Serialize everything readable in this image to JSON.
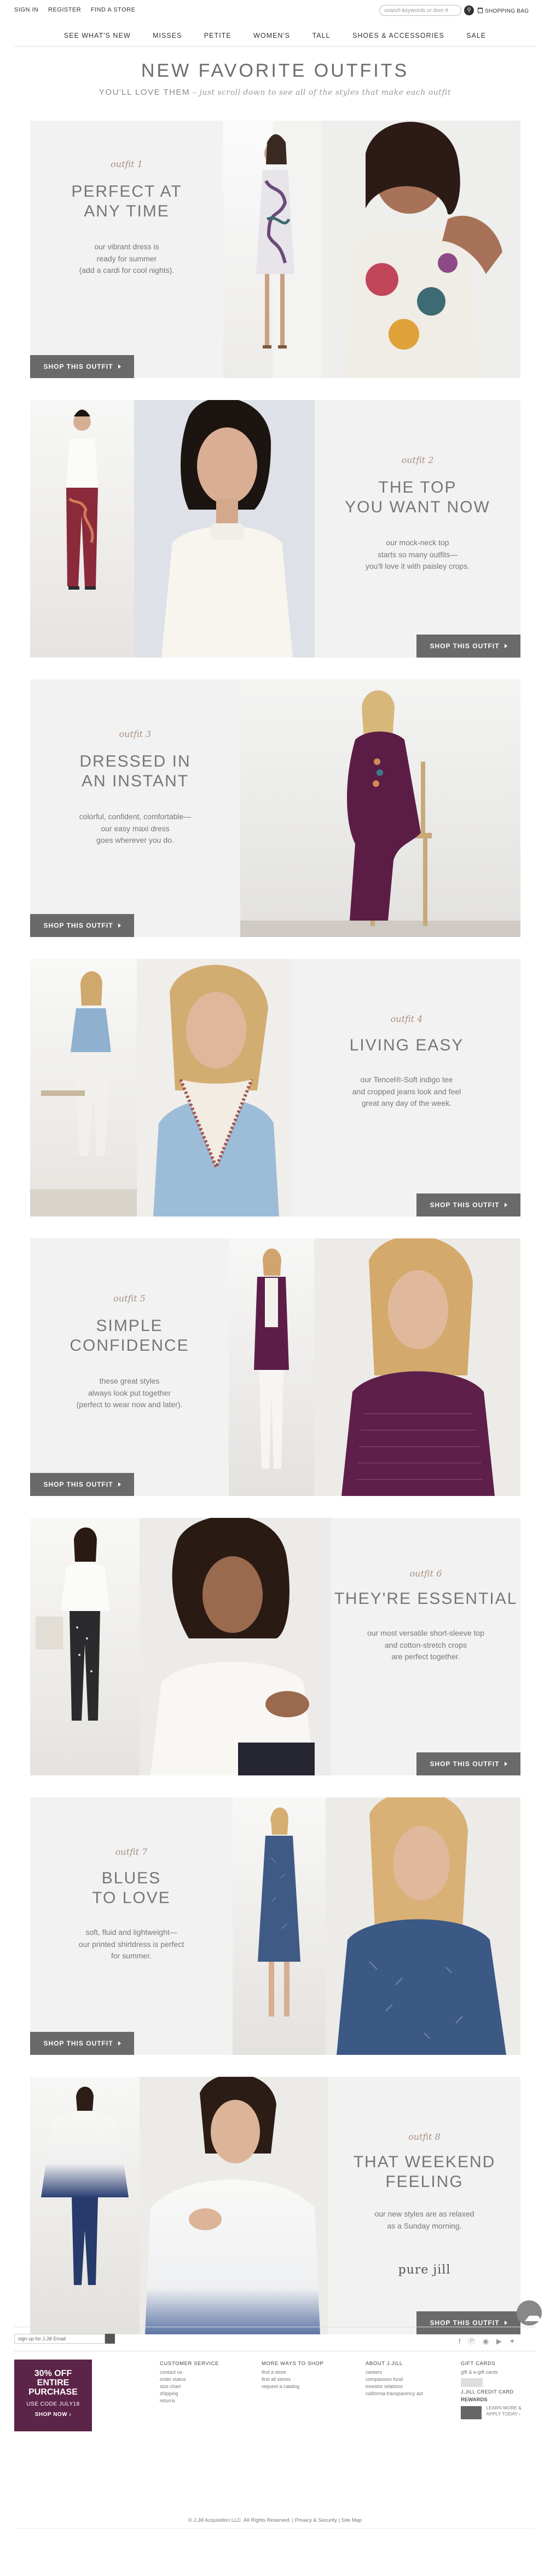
{
  "header": {
    "links": [
      "SIGN IN",
      "REGISTER",
      "FIND A STORE"
    ],
    "search_placeholder": "search keywords or item #",
    "bag_label": "SHOPPING BAG"
  },
  "nav": [
    "SEE WHAT'S NEW",
    "MISSES",
    "PETITE",
    "WOMEN'S",
    "TALL",
    "SHOES & ACCESSORIES",
    "SALE"
  ],
  "hero": {
    "title": "NEW FAVORITE OUTFITS",
    "subtitle": "YOU'LL LOVE THEM",
    "subtitle_italic": " – just scroll down to see all of the styles that make each outfit"
  },
  "shop_label": "SHOP THIS OUTFIT",
  "outfits": [
    {
      "name": "outfit 1",
      "title": [
        "PERFECT AT",
        "ANY TIME"
      ],
      "desc": [
        "our vibrant dress is",
        "ready for summer",
        "(add a cardi for cool nights)."
      ]
    },
    {
      "name": "outfit 2",
      "title": [
        "THE TOP",
        "YOU WANT NOW"
      ],
      "desc": [
        "our mock-neck top",
        "starts so many outfits—",
        "you'll love it with paisley crops."
      ]
    },
    {
      "name": "outfit 3",
      "title": [
        "DRESSED IN",
        "AN INSTANT"
      ],
      "desc": [
        "colorful, confident, comfortable—",
        "our easy maxi dress",
        "goes wherever you do."
      ]
    },
    {
      "name": "outfit 4",
      "title": [
        "LIVING EASY"
      ],
      "desc": [
        "our Tencel®-Soft indigo tee",
        "and cropped jeans look and feel",
        "great any day of the week."
      ]
    },
    {
      "name": "outfit 5",
      "title": [
        "SIMPLE",
        "CONFIDENCE"
      ],
      "desc": [
        "these great styles",
        "always look put together",
        "(perfect to wear now and later)."
      ]
    },
    {
      "name": "outfit 6",
      "title": [
        "THEY'RE ESSENTIAL"
      ],
      "desc": [
        "our most versatile short-sleeve top",
        "and cotton-stretch crops",
        "are perfect together."
      ]
    },
    {
      "name": "outfit 7",
      "title": [
        "BLUES",
        "TO LOVE"
      ],
      "desc": [
        "soft, fluid and lightweight—",
        "our printed shirtdress is perfect",
        "for summer."
      ]
    },
    {
      "name": "outfit 8",
      "title": [
        "THAT WEEKEND",
        "FEELING"
      ],
      "desc": [
        "our new styles are as relaxed",
        "as a Sunday morning."
      ],
      "brand": "pure jill"
    }
  ],
  "footer": {
    "email_placeholder": "sign up for J.Jill Email",
    "promo": {
      "line1": "30% OFF",
      "line2": "ENTIRE",
      "line3": "PURCHASE",
      "code": "USE CODE JULY18",
      "cta": "SHOP NOW ›"
    },
    "columns": [
      {
        "heading": "CUSTOMER SERVICE",
        "items": [
          "contact us",
          "order status",
          "size chart",
          "shipping",
          "returns"
        ]
      },
      {
        "heading": "MORE WAYS TO SHOP",
        "items": [
          "find a store",
          "find all stores",
          "request a catalog"
        ]
      },
      {
        "heading": "ABOUT J.JILL",
        "items": [
          "careers",
          "compassion fund",
          "investor relations",
          "california transparency act"
        ]
      },
      {
        "heading": "GIFT CARDS",
        "items": [
          "gift & e-gift cards"
        ]
      }
    ],
    "rewards": {
      "heading": "J.JILL CREDIT CARD",
      "name": "REWARDS",
      "cta1": "LEARN MORE &",
      "cta2": "APPLY TODAY ›"
    },
    "copyright": "© J.Jill Acquisition LLC. All Rights Reserved. | Privacy & Security | Site Map"
  },
  "colors": {
    "panel": "#f3f2f2",
    "button": "#6a6a6a",
    "accent": "#a79180",
    "promo": "#5c2448"
  }
}
